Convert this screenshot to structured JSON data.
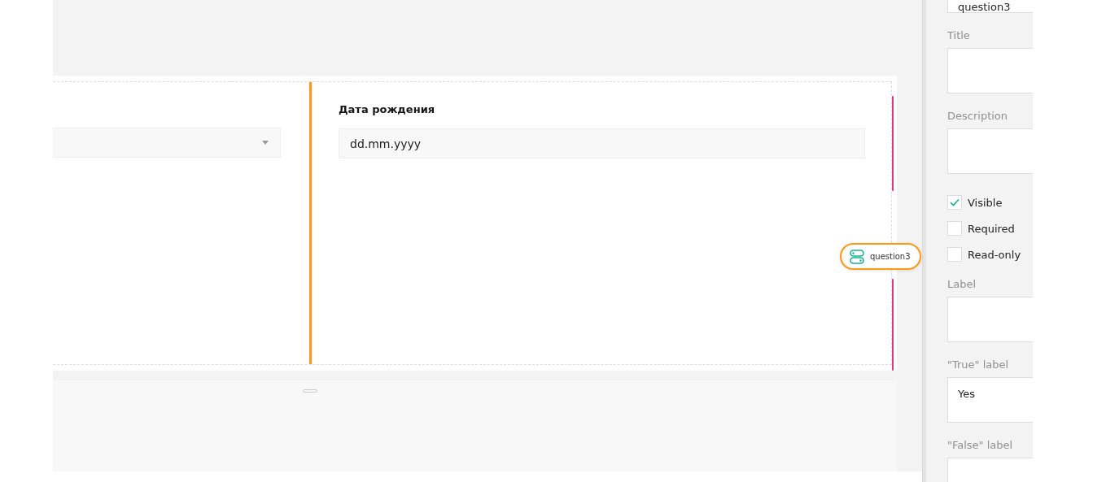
{
  "form": {
    "left_question": {
      "kind": "dropdown"
    },
    "right_question": {
      "title": "Дата рождения",
      "placeholder": "dd.mm.yyyy"
    },
    "selected_badge": {
      "name": "question3"
    }
  },
  "properties": [
    {
      "kind": "field",
      "value": "question3"
    },
    {
      "kind": "field",
      "label": "Title"
    },
    {
      "kind": "field",
      "label": "Description"
    },
    {
      "kind": "checkbox",
      "label": "Visible",
      "checked": true
    },
    {
      "kind": "checkbox",
      "label": "Required",
      "checked": false
    },
    {
      "kind": "checkbox",
      "label": "Read-only",
      "checked": false
    },
    {
      "kind": "field",
      "label": "Label"
    },
    {
      "kind": "field",
      "label": "\"True\" label",
      "value": "Yes"
    },
    {
      "kind": "field",
      "label": "\"False\" label"
    }
  ]
}
